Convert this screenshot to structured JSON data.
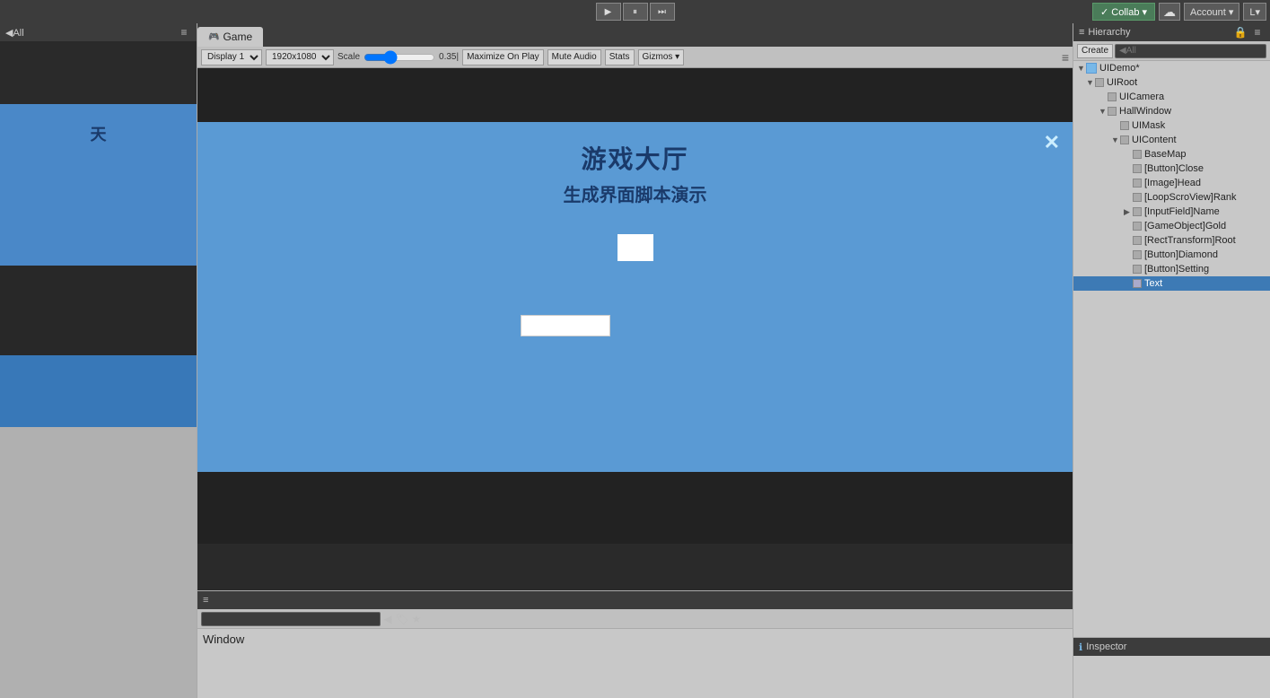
{
  "toolbar": {
    "collab_label": "Collab ▾",
    "account_label": "Account ▾",
    "layers_label": "L▾"
  },
  "left_panel": {
    "search_placeholder": "◀All",
    "menu_icon": "≡"
  },
  "game_panel": {
    "tab_label": "Game",
    "tab_icon": "🎮",
    "display_label": "Display 1",
    "resolution_label": "1920x1080",
    "scale_label": "Scale",
    "scale_value": "0.35|",
    "maximize_label": "Maximize On Play",
    "mute_label": "Mute Audio",
    "stats_label": "Stats",
    "gizmos_label": "Gizmos ▾",
    "menu_icon": "≡"
  },
  "game_ui": {
    "title": "游戏大厅",
    "subtitle": "生成界面脚本演示",
    "close_icon": "✕"
  },
  "hierarchy": {
    "title": "Hierarchy",
    "create_label": "Create",
    "search_placeholder": "◀All",
    "menu_icon": "≡",
    "lock_icon": "🔒",
    "items": [
      {
        "label": "UIDemo*",
        "level": 0,
        "arrow": "▼",
        "icon": "scene"
      },
      {
        "label": "UIRoot",
        "level": 1,
        "arrow": "▼",
        "icon": "cube"
      },
      {
        "label": "UICamera",
        "level": 2,
        "arrow": "",
        "icon": "cube"
      },
      {
        "label": "HallWindow",
        "level": 2,
        "arrow": "▼",
        "icon": "cube"
      },
      {
        "label": "UIMask",
        "level": 3,
        "arrow": "",
        "icon": "cube"
      },
      {
        "label": "UIContent",
        "level": 3,
        "arrow": "▼",
        "icon": "cube"
      },
      {
        "label": "BaseMap",
        "level": 4,
        "arrow": "",
        "icon": "cube"
      },
      {
        "label": "[Button]Close",
        "level": 4,
        "arrow": "",
        "icon": "cube"
      },
      {
        "label": "[Image]Head",
        "level": 4,
        "arrow": "",
        "icon": "cube"
      },
      {
        "label": "[LoopScroView]Rank",
        "level": 4,
        "arrow": "",
        "icon": "cube"
      },
      {
        "label": "[InputField]Name",
        "level": 4,
        "arrow": "▶",
        "icon": "cube"
      },
      {
        "label": "[GameObject]Gold",
        "level": 4,
        "arrow": "",
        "icon": "cube"
      },
      {
        "label": "[RectTransform]Root",
        "level": 4,
        "arrow": "",
        "icon": "cube"
      },
      {
        "label": "[Button]Diamond",
        "level": 4,
        "arrow": "",
        "icon": "cube"
      },
      {
        "label": "[Button]Setting",
        "level": 4,
        "arrow": "",
        "icon": "cube"
      },
      {
        "label": "Text",
        "level": 4,
        "arrow": "",
        "icon": "cube",
        "selected": true
      }
    ]
  },
  "inspector": {
    "title": "Inspector"
  },
  "bottom_panel": {
    "window_label": "Window",
    "search_placeholder": ""
  }
}
